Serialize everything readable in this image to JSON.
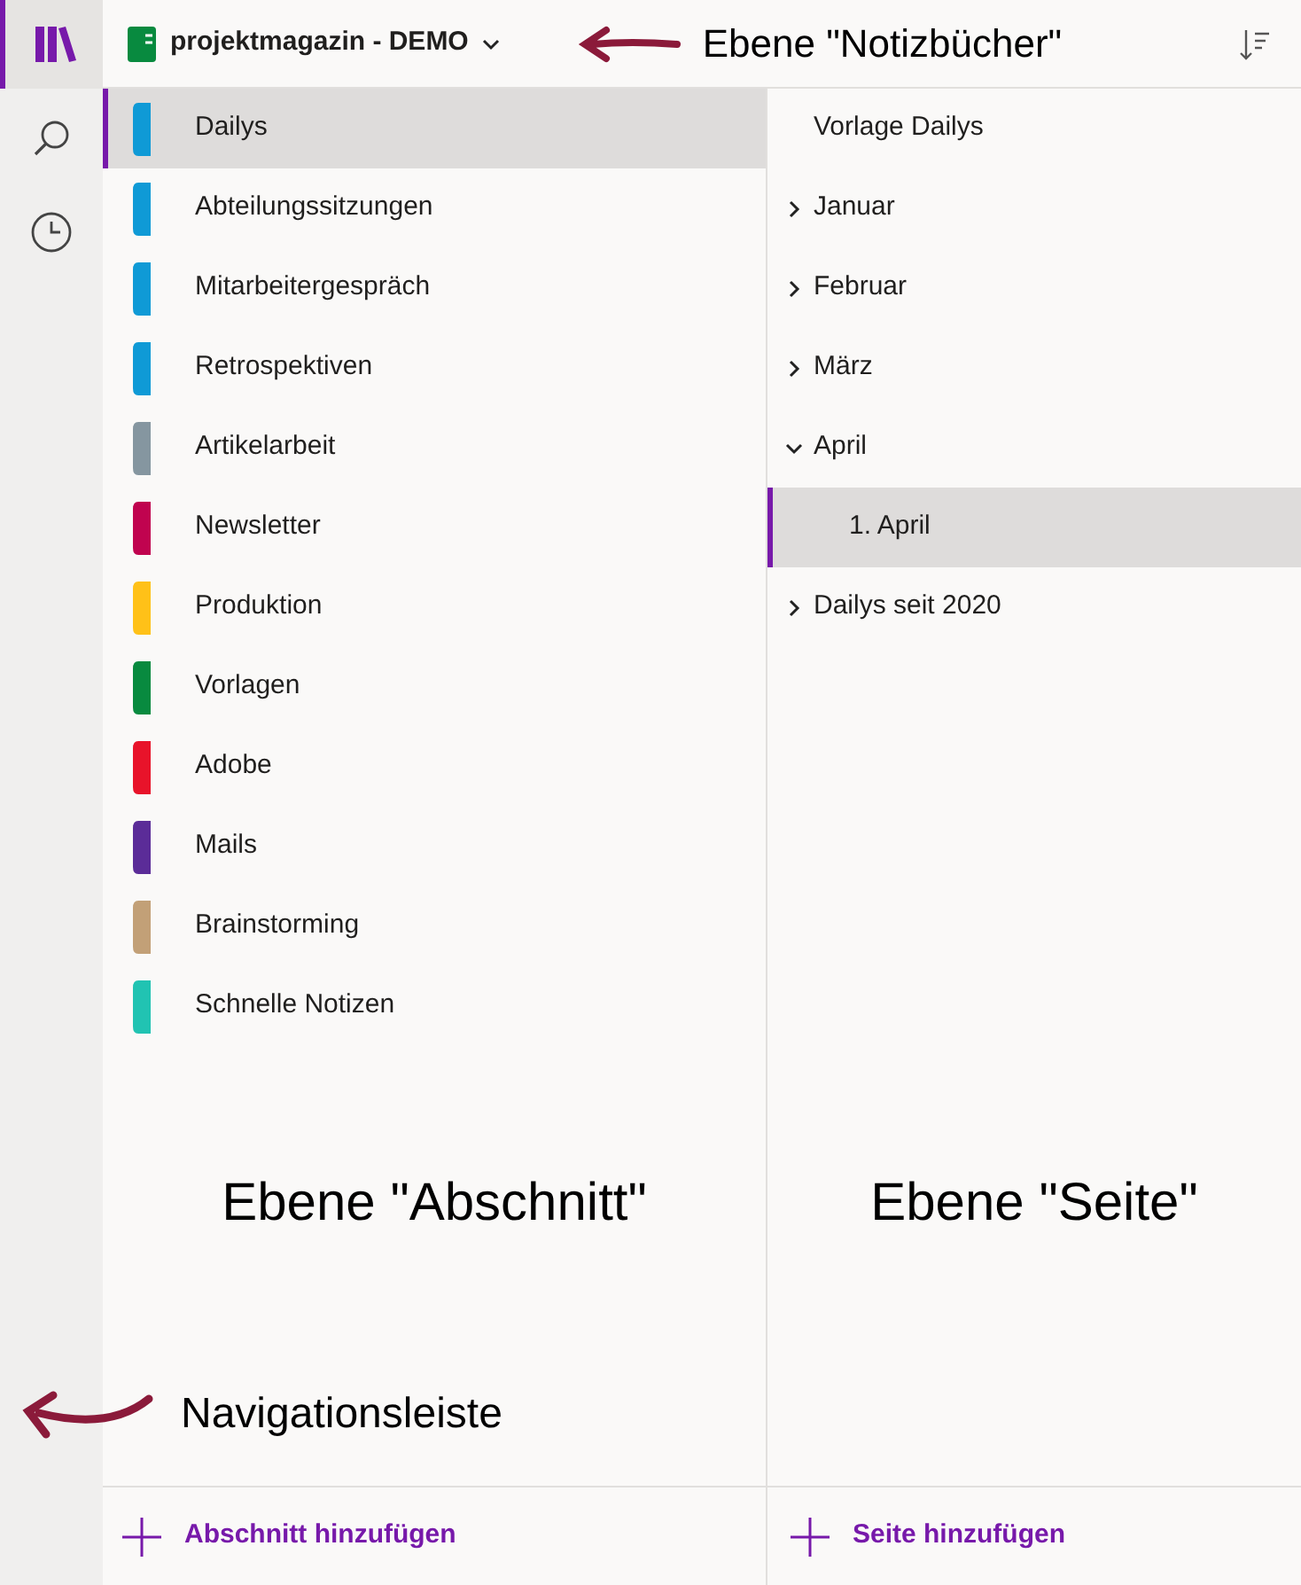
{
  "notebook": {
    "title": "projektmagazin - DEMO"
  },
  "annotations": {
    "notebooks": "Ebene \"Notizbücher\"",
    "sections": "Ebene \"Abschnitt\"",
    "pages": "Ebene \"Seite\"",
    "navigation": "Navigationsleiste"
  },
  "sections": [
    {
      "label": "Dailys",
      "color": "#0f9ad6",
      "selected": true
    },
    {
      "label": "Abteilungssitzungen",
      "color": "#0f9ad6",
      "selected": false
    },
    {
      "label": "Mitarbeitergespräch",
      "color": "#0f9ad6",
      "selected": false
    },
    {
      "label": "Retrospektiven",
      "color": "#0f9ad6",
      "selected": false
    },
    {
      "label": "Artikelarbeit",
      "color": "#8596a0",
      "selected": false
    },
    {
      "label": "Newsletter",
      "color": "#c0034f",
      "selected": false
    },
    {
      "label": "Produktion",
      "color": "#ffc118",
      "selected": false
    },
    {
      "label": "Vorlagen",
      "color": "#088a3f",
      "selected": false
    },
    {
      "label": "Adobe",
      "color": "#e8132a",
      "selected": false
    },
    {
      "label": "Mails",
      "color": "#5b2c98",
      "selected": false
    },
    {
      "label": "Brainstorming",
      "color": "#c2a077",
      "selected": false
    },
    {
      "label": "Schnelle Notizen",
      "color": "#21c3b2",
      "selected": false
    }
  ],
  "pages": [
    {
      "kind": "page",
      "label": "Vorlage Dailys",
      "selected": false
    },
    {
      "kind": "group",
      "label": "Januar",
      "expanded": false,
      "selected": false
    },
    {
      "kind": "group",
      "label": "Februar",
      "expanded": false,
      "selected": false
    },
    {
      "kind": "group",
      "label": "März",
      "expanded": false,
      "selected": false
    },
    {
      "kind": "group",
      "label": "April",
      "expanded": true,
      "selected": false,
      "children": [
        {
          "kind": "page",
          "label": "1. April",
          "selected": true
        }
      ]
    },
    {
      "kind": "group",
      "label": "Dailys seit 2020",
      "expanded": false,
      "selected": false
    }
  ],
  "footer": {
    "add_section": "Abschnitt hinzufügen",
    "add_page": "Seite hinzufügen"
  }
}
